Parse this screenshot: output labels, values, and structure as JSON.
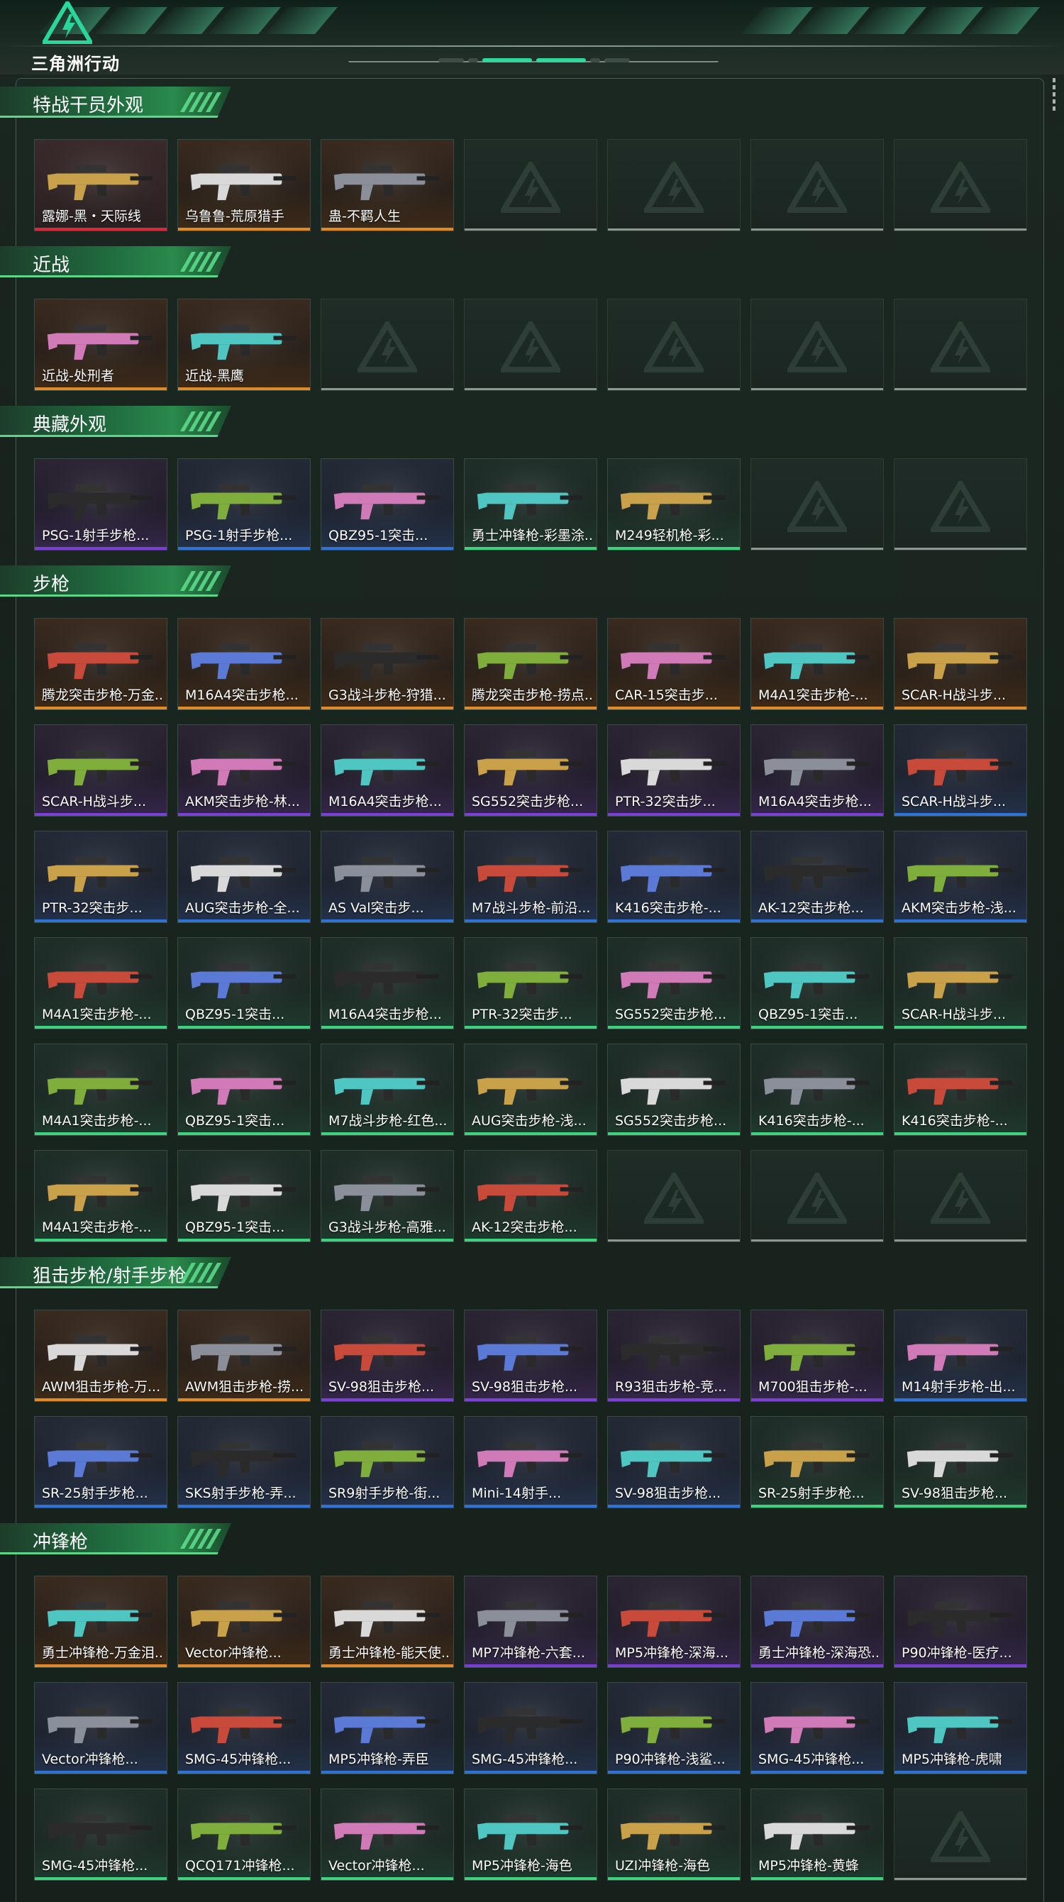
{
  "header": {
    "logo_text": "三角洲行动",
    "icon": "triangle-logo-icon"
  },
  "colors": {
    "gold": "#e08a2a",
    "purple": "#7a3fd6",
    "blue": "#2f73d8",
    "green": "#3fd27e",
    "red": "#d8283c",
    "gray": "#8c9893"
  },
  "sections": [
    {
      "title": "特战干员外观",
      "rows": [
        [
          {
            "label": "露娜-黑・天际线",
            "tier": "red"
          },
          {
            "label": "乌鲁鲁-荒原猎手",
            "tier": "gold"
          },
          {
            "label": "蛊-不羁人生",
            "tier": "gold"
          },
          null,
          null,
          null,
          null
        ]
      ]
    },
    {
      "title": "近战",
      "rows": [
        [
          {
            "label": "近战-处刑者",
            "tier": "gold"
          },
          {
            "label": "近战-黑鹰",
            "tier": "gold"
          },
          null,
          null,
          null,
          null,
          null
        ]
      ]
    },
    {
      "title": "典藏外观",
      "rows": [
        [
          {
            "label": "PSG-1射手步枪...",
            "tier": "purple"
          },
          {
            "label": "PSG-1射手步枪...",
            "tier": "blue"
          },
          {
            "label": "QBZ95-1突击...",
            "tier": "blue"
          },
          {
            "label": "勇士冲锋枪-彩墨涂...",
            "tier": "green"
          },
          {
            "label": "M249轻机枪-彩...",
            "tier": "green"
          },
          null,
          null
        ]
      ]
    },
    {
      "title": "步枪",
      "rows": [
        [
          {
            "label": "腾龙突击步枪-万金...",
            "tier": "gold"
          },
          {
            "label": "M16A4突击步枪...",
            "tier": "gold"
          },
          {
            "label": "G3战斗步枪-狩猎...",
            "tier": "gold"
          },
          {
            "label": "腾龙突击步枪-捞点...",
            "tier": "gold"
          },
          {
            "label": "CAR-15突击步...",
            "tier": "gold"
          },
          {
            "label": "M4A1突击步枪-...",
            "tier": "gold"
          },
          {
            "label": "SCAR-H战斗步...",
            "tier": "gold"
          }
        ],
        [
          {
            "label": "SCAR-H战斗步...",
            "tier": "purple"
          },
          {
            "label": "AKM突击步枪-林...",
            "tier": "purple"
          },
          {
            "label": "M16A4突击步枪...",
            "tier": "purple"
          },
          {
            "label": "SG552突击步枪...",
            "tier": "purple"
          },
          {
            "label": "PTR-32突击步...",
            "tier": "purple"
          },
          {
            "label": "M16A4突击步枪...",
            "tier": "purple"
          },
          {
            "label": "SCAR-H战斗步...",
            "tier": "blue"
          }
        ],
        [
          {
            "label": "PTR-32突击步...",
            "tier": "blue"
          },
          {
            "label": "AUG突击步枪-全...",
            "tier": "blue"
          },
          {
            "label": "AS Val突击步...",
            "tier": "blue"
          },
          {
            "label": "M7战斗步枪-前沿...",
            "tier": "blue"
          },
          {
            "label": "K416突击步枪-...",
            "tier": "blue"
          },
          {
            "label": "AK-12突击步枪...",
            "tier": "blue"
          },
          {
            "label": "AKM突击步枪-浅...",
            "tier": "blue"
          }
        ],
        [
          {
            "label": "M4A1突击步枪-...",
            "tier": "green"
          },
          {
            "label": "QBZ95-1突击...",
            "tier": "green"
          },
          {
            "label": "M16A4突击步枪...",
            "tier": "green"
          },
          {
            "label": "PTR-32突击步...",
            "tier": "green"
          },
          {
            "label": "SG552突击步枪...",
            "tier": "green"
          },
          {
            "label": "QBZ95-1突击...",
            "tier": "green"
          },
          {
            "label": "SCAR-H战斗步...",
            "tier": "green"
          }
        ],
        [
          {
            "label": "M4A1突击步枪-...",
            "tier": "green"
          },
          {
            "label": "QBZ95-1突击...",
            "tier": "green"
          },
          {
            "label": "M7战斗步枪-红色...",
            "tier": "green"
          },
          {
            "label": "AUG突击步枪-浅...",
            "tier": "green"
          },
          {
            "label": "SG552突击步枪...",
            "tier": "green"
          },
          {
            "label": "K416突击步枪-...",
            "tier": "green"
          },
          {
            "label": "K416突击步枪-...",
            "tier": "green"
          }
        ],
        [
          {
            "label": "M4A1突击步枪-...",
            "tier": "green"
          },
          {
            "label": "QBZ95-1突击...",
            "tier": "green"
          },
          {
            "label": "G3战斗步枪-高雅...",
            "tier": "green"
          },
          {
            "label": "AK-12突击步枪...",
            "tier": "green"
          },
          null,
          null,
          null
        ]
      ]
    },
    {
      "title": "狙击步枪/射手步枪",
      "rows": [
        [
          {
            "label": "AWM狙击步枪-万...",
            "tier": "gold"
          },
          {
            "label": "AWM狙击步枪-捞...",
            "tier": "gold"
          },
          {
            "label": "SV-98狙击步枪...",
            "tier": "purple"
          },
          {
            "label": "SV-98狙击步枪...",
            "tier": "purple"
          },
          {
            "label": "R93狙击步枪-竞...",
            "tier": "purple"
          },
          {
            "label": "M700狙击步枪-...",
            "tier": "purple"
          },
          {
            "label": "M14射手步枪-出...",
            "tier": "blue"
          }
        ],
        [
          {
            "label": "SR-25射手步枪...",
            "tier": "blue"
          },
          {
            "label": "SKS射手步枪-弄...",
            "tier": "blue"
          },
          {
            "label": "SR9射手步枪-街...",
            "tier": "blue"
          },
          {
            "label": "Mini-14射手...",
            "tier": "blue"
          },
          {
            "label": "SV-98狙击步枪...",
            "tier": "blue"
          },
          {
            "label": "SR-25射手步枪...",
            "tier": "green"
          },
          {
            "label": "SV-98狙击步枪...",
            "tier": "green"
          }
        ]
      ]
    },
    {
      "title": "冲锋枪",
      "rows": [
        [
          {
            "label": "勇士冲锋枪-万金泪...",
            "tier": "gold"
          },
          {
            "label": "Vector冲锋枪...",
            "tier": "gold"
          },
          {
            "label": "勇士冲锋枪-能天使...",
            "tier": "gold"
          },
          {
            "label": "MP7冲锋枪-六套...",
            "tier": "purple"
          },
          {
            "label": "MP5冲锋枪-深海...",
            "tier": "purple"
          },
          {
            "label": "勇士冲锋枪-深海恐...",
            "tier": "purple"
          },
          {
            "label": "P90冲锋枪-医疗...",
            "tier": "purple"
          }
        ],
        [
          {
            "label": "Vector冲锋枪...",
            "tier": "blue"
          },
          {
            "label": "SMG-45冲锋枪...",
            "tier": "blue"
          },
          {
            "label": "MP5冲锋枪-弄臣",
            "tier": "blue"
          },
          {
            "label": "SMG-45冲锋枪...",
            "tier": "blue"
          },
          {
            "label": "P90冲锋枪-浅鲨...",
            "tier": "blue"
          },
          {
            "label": "SMG-45冲锋枪...",
            "tier": "blue"
          },
          {
            "label": "MP5冲锋枪-虎啸",
            "tier": "blue"
          }
        ],
        [
          {
            "label": "SMG-45冲锋枪...",
            "tier": "green"
          },
          {
            "label": "QCQ171冲锋枪...",
            "tier": "green"
          },
          {
            "label": "Vector冲锋枪...",
            "tier": "green"
          },
          {
            "label": "MP5冲锋枪-海色",
            "tier": "green"
          },
          {
            "label": "UZI冲锋枪-海色",
            "tier": "green"
          },
          {
            "label": "MP5冲锋枪-黄蜂",
            "tier": "green"
          },
          null
        ]
      ]
    }
  ]
}
